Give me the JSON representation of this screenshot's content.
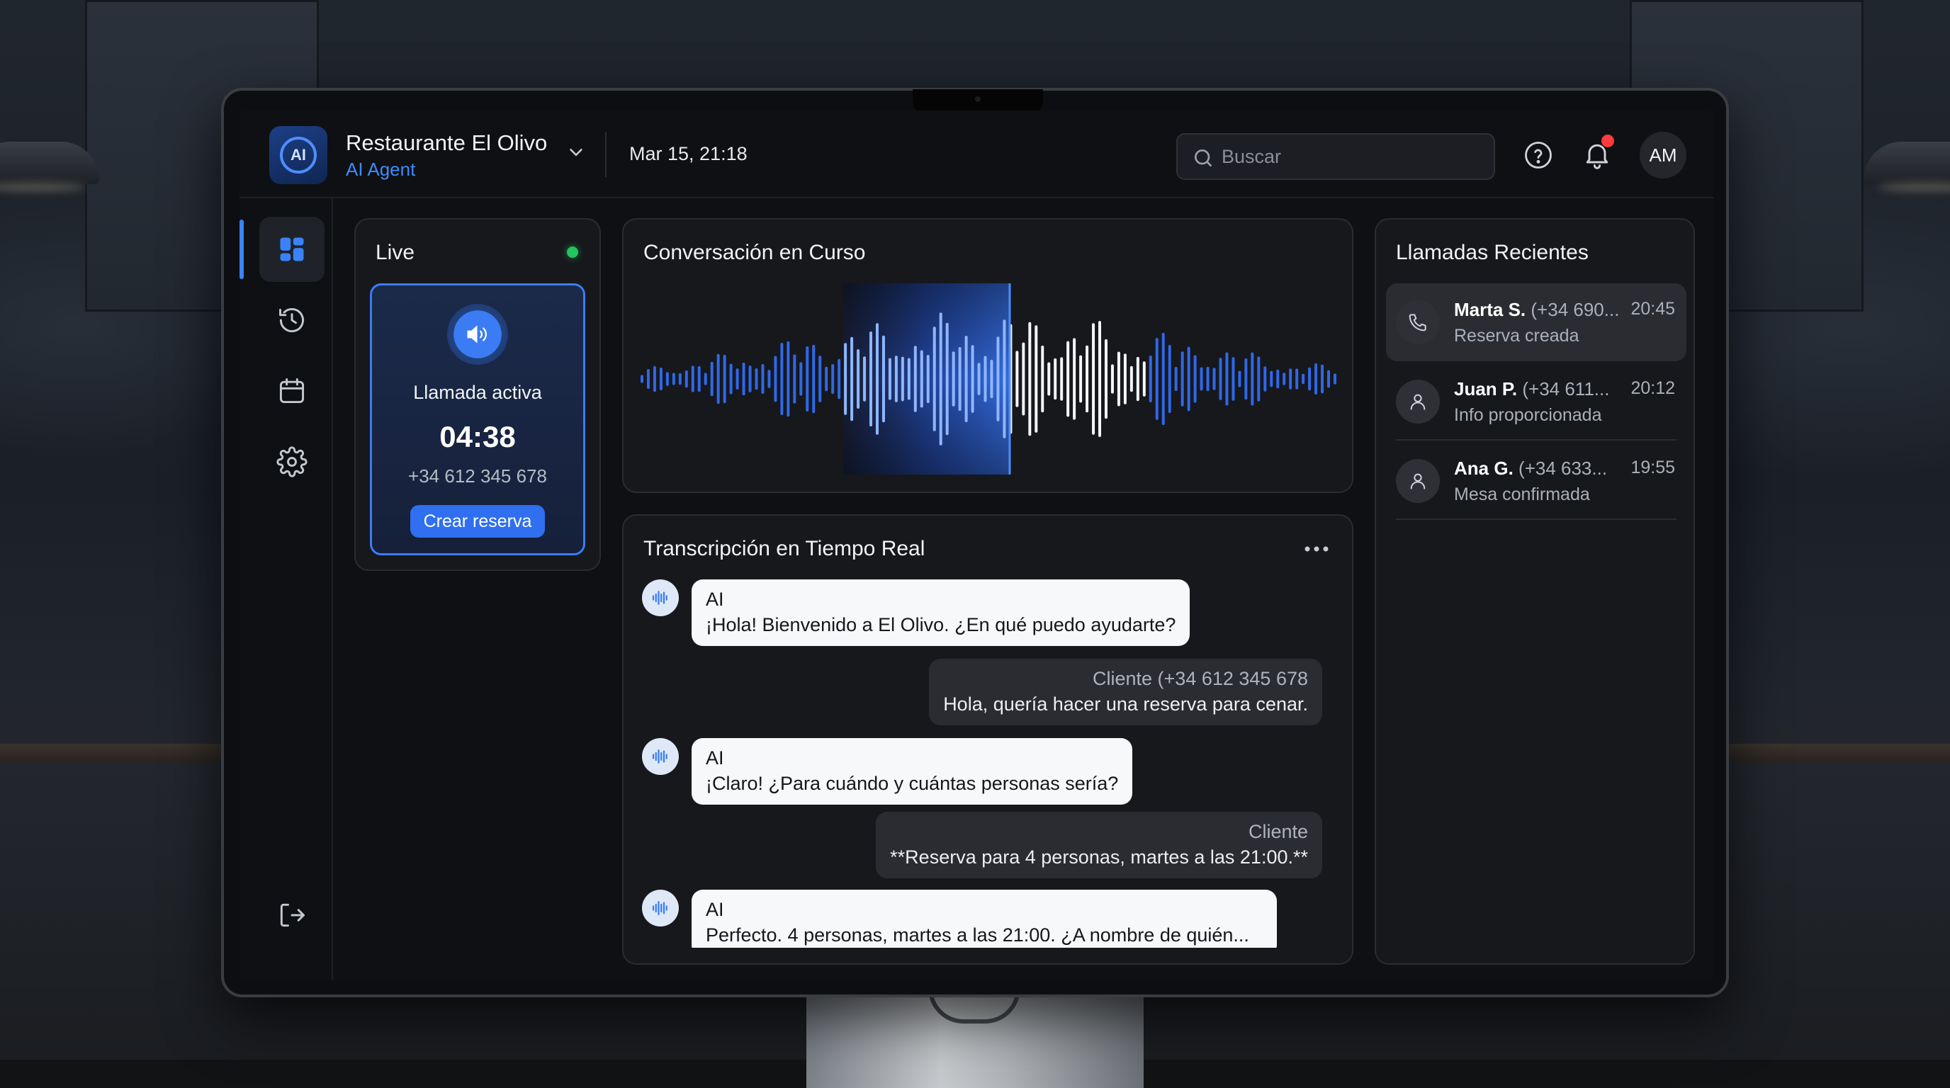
{
  "header": {
    "logo_text": "AI",
    "restaurant_name": "Restaurante El Olivo",
    "subtitle": "AI Agent",
    "datetime": "Mar 15, 21:18",
    "search_placeholder": "Buscar",
    "avatar_initials": "AM"
  },
  "sidebar": {
    "items": [
      {
        "icon": "dashboard-icon",
        "active": true
      },
      {
        "icon": "history-icon",
        "active": false
      },
      {
        "icon": "calendar-icon",
        "active": false
      },
      {
        "icon": "settings-icon",
        "active": false
      },
      {
        "icon": "logout-icon",
        "active": false
      }
    ]
  },
  "live": {
    "title": "Live",
    "status": "Llamada activa",
    "timer": "04:38",
    "phone": "+34 612 345 678",
    "button_label": "Crear reserva"
  },
  "conversation": {
    "title": "Conversación en Curso"
  },
  "transcript": {
    "title": "Transcripción en Tiempo Real",
    "messages": [
      {
        "speaker": "AI",
        "text": "¡Hola! Bienvenido a El Olivo. ¿En qué puedo ayudarte?"
      },
      {
        "speaker": "Cliente (+34 612 345 678",
        "text": "Hola, quería hacer una reserva para cenar."
      },
      {
        "speaker": "AI",
        "text": "¡Claro! ¿Para cuándo y cuántas personas sería?"
      },
      {
        "speaker": "Cliente",
        "text": "**Reserva para 4 personas, martes a las 21:00.**"
      },
      {
        "speaker": "AI",
        "text": "Perfecto. 4 personas, martes a las 21:00. ¿A nombre de quién..."
      }
    ]
  },
  "recent_calls": {
    "title": "Llamadas Recientes",
    "items": [
      {
        "name": "Marta S.",
        "number": "(+34 690...",
        "time": "20:45",
        "status": "Reserva creada",
        "icon": "phone-icon"
      },
      {
        "name": "Juan P.",
        "number": "(+34 611...",
        "time": "20:12",
        "status": "Info proporcionada",
        "icon": "user-icon"
      },
      {
        "name": "Ana G.",
        "number": "(+34 633...",
        "time": "19:55",
        "status": "Mesa confirmada",
        "icon": "user-icon"
      }
    ]
  },
  "colors": {
    "accent": "#3b82f6",
    "live_indicator": "#22c55e",
    "notification": "#ff3b3b"
  }
}
